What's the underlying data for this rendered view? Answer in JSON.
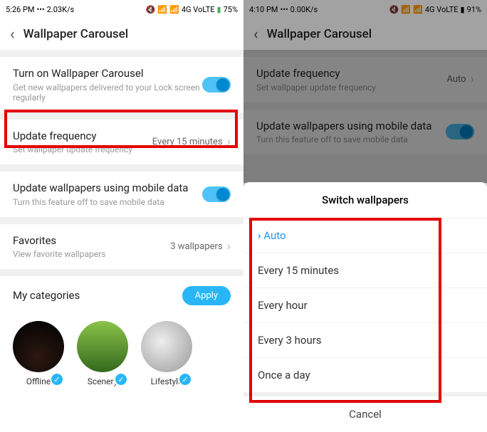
{
  "left": {
    "status": {
      "time": "5:26 PM",
      "speed": "2.03K/s",
      "net": "4G VoLTE",
      "battery": "75%"
    },
    "title": "Wallpaper Carousel",
    "rows": {
      "carousel": {
        "title": "Turn on Wallpaper Carousel",
        "sub": "Get new wallpapers delivered to your Lock screen regularly"
      },
      "freq": {
        "title": "Update frequency",
        "sub": "Set wallpaper update frequency",
        "value": "Every 15 minutes"
      },
      "mobile": {
        "title": "Update wallpapers using mobile data",
        "sub": "Turn this feature off to save mobile data"
      },
      "fav": {
        "title": "Favorites",
        "sub": "View favorite wallpapers",
        "value": "3 wallpapers"
      }
    },
    "mycats": "My categories",
    "apply": "Apply",
    "cats": [
      "Offline",
      "Scenery",
      "Lifestyle"
    ]
  },
  "right": {
    "status": {
      "time": "4:10 PM",
      "speed": "0.00K/s",
      "net": "4G VoLTE",
      "battery": "91%"
    },
    "title": "Wallpaper Carousel",
    "rows": {
      "freq": {
        "title": "Update frequency",
        "sub": "Set wallpaper update frequency",
        "value": "Auto"
      },
      "mobile": {
        "title": "Update wallpapers using mobile data",
        "sub": "Turn this feature off to save mobile data"
      }
    },
    "sheet": {
      "title": "Switch wallpapers",
      "opts": [
        "Auto",
        "Every 15 minutes",
        "Every hour",
        "Every 3 hours",
        "Once a day"
      ],
      "cancel": "Cancel"
    }
  }
}
